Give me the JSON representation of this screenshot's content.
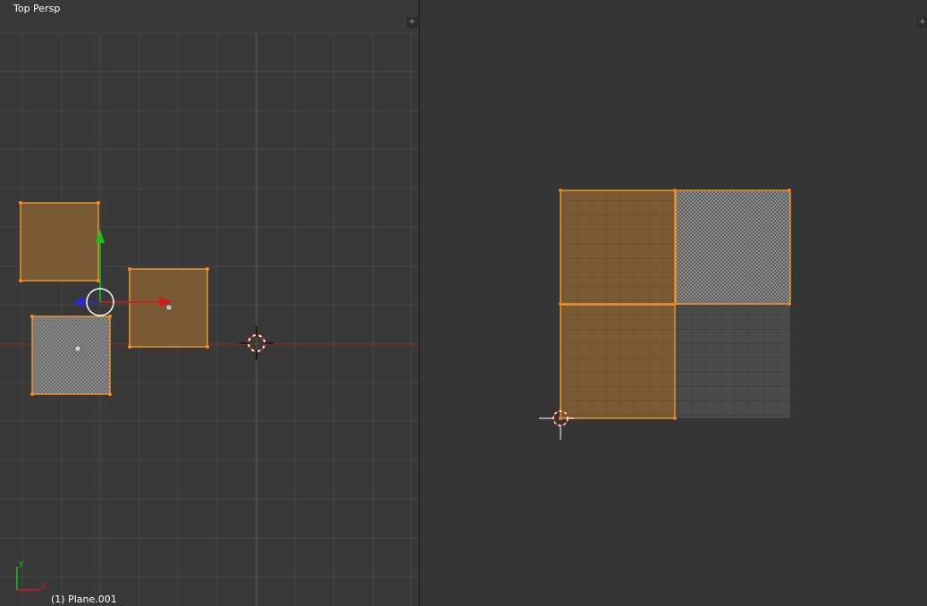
{
  "viewport": {
    "view_name": "Top Persp",
    "active_object": "(1) Plane.001",
    "axis_labels": {
      "x": "x",
      "y": "y"
    },
    "corner_glyph": "+"
  },
  "uv_editor": {
    "corner_glyph": "+"
  },
  "icons": [
    "3d-cursor-icon",
    "move-gizmo-icon",
    "area-split-icon",
    "axis-orientation-icon"
  ],
  "colors": {
    "background": "#393939",
    "uv_background": "#353535",
    "grid": "#454545",
    "x_axis": "#8a2a2a",
    "y_axis": "#2f7a2f",
    "selected_face": "#7a5a35",
    "selected_edge": "#e8962a",
    "gizmo_x": "#d81818",
    "gizmo_y": "#18c018",
    "gizmo_z": "#2828e0"
  }
}
